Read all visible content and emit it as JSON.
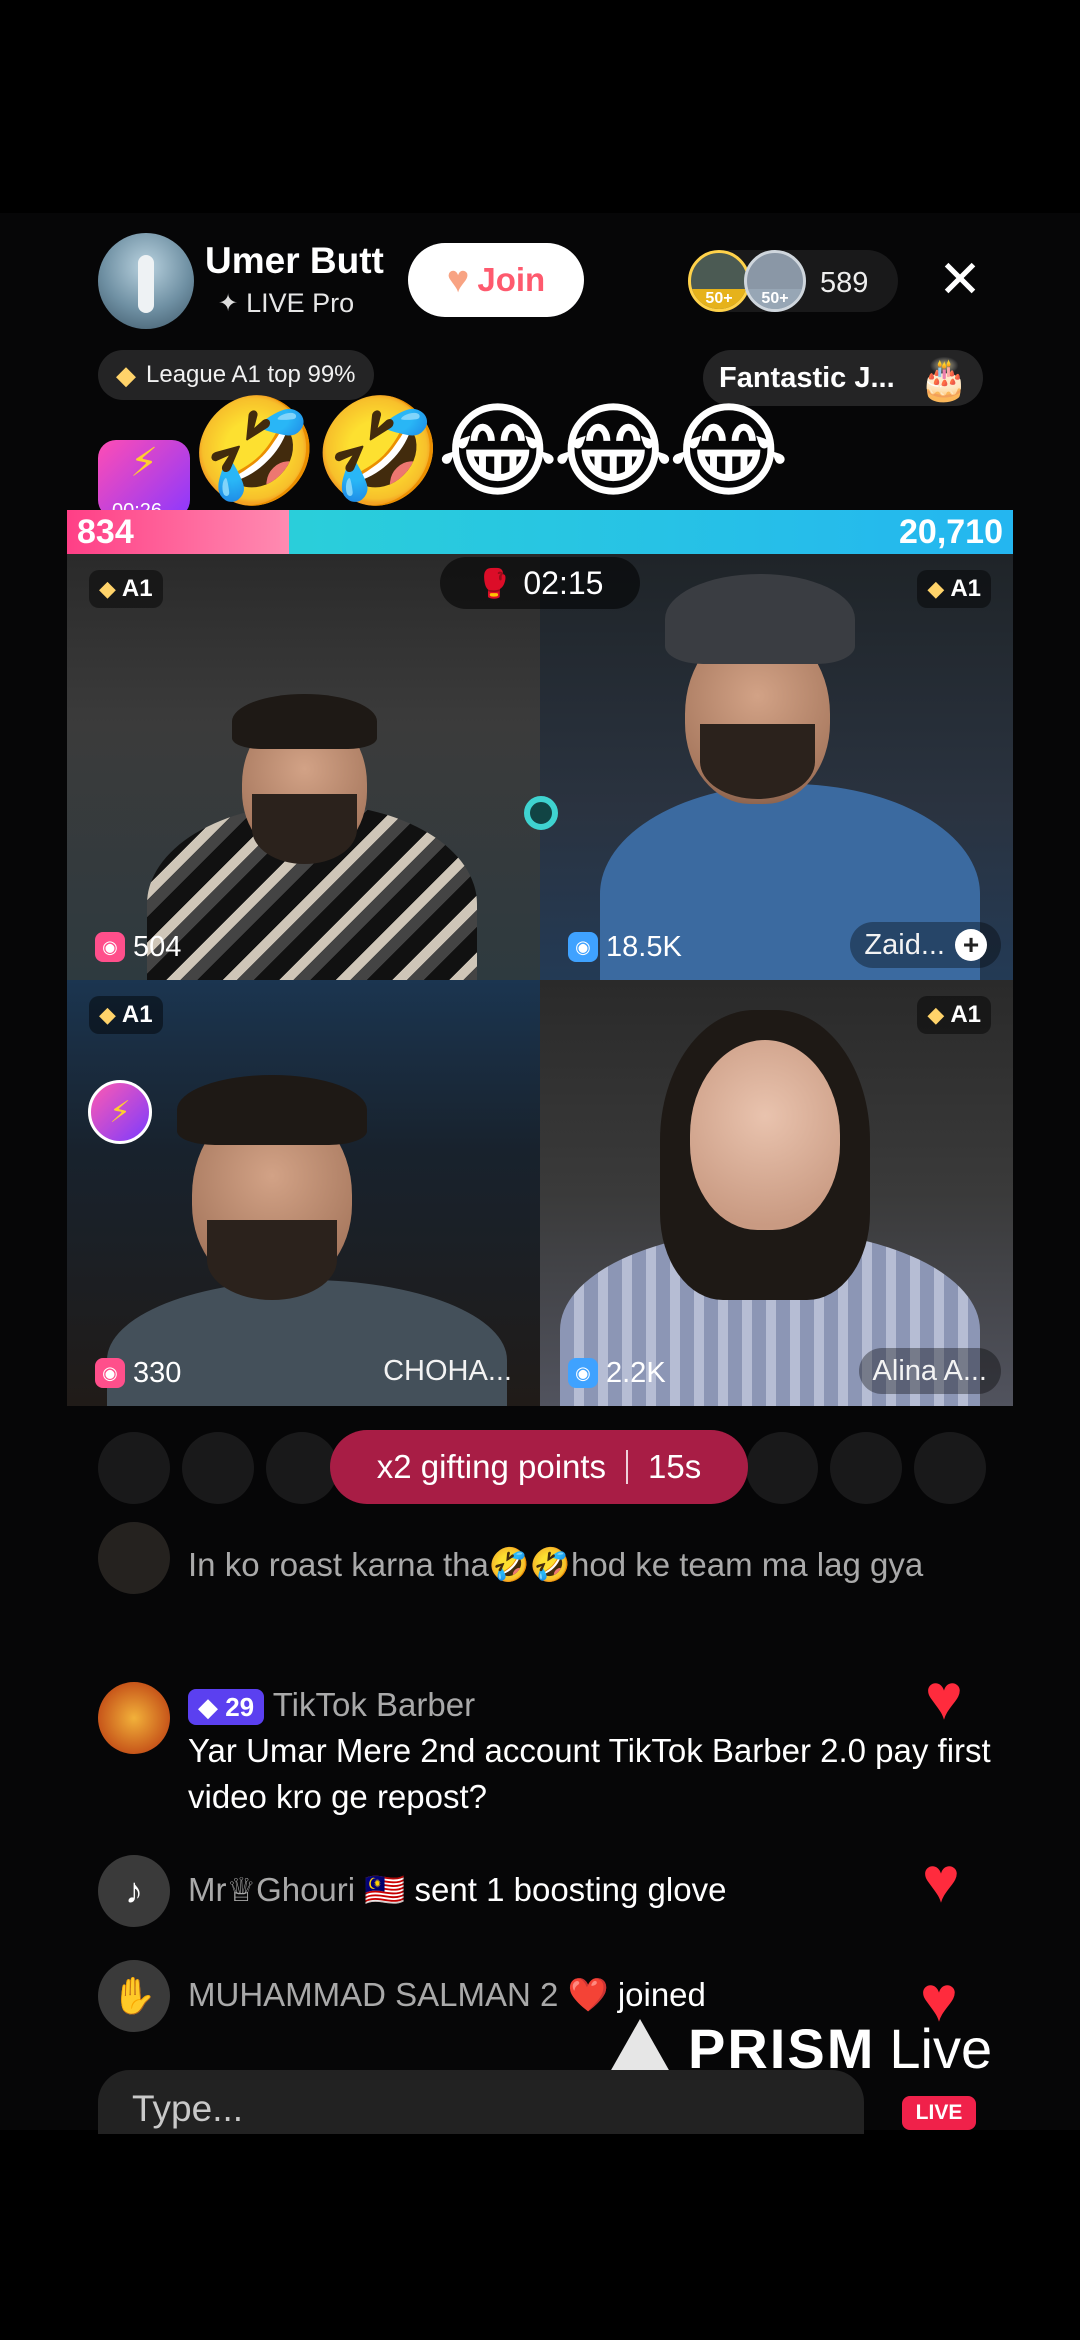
{
  "header": {
    "host_name": "Umer Butt",
    "host_subtitle": "LIVE Pro",
    "join_label": "Join",
    "viewer_rank_badges": [
      "50+",
      "50+"
    ],
    "viewer_count": "589",
    "league_label": "League A1 top 99%",
    "fantastic_label": "Fantastic J..."
  },
  "emoji_reactions": "🤣🤣😂😂😂",
  "boost_timer": "00:26",
  "battle": {
    "left_score": "834",
    "right_score": "20,710",
    "timer": "02:15"
  },
  "tiles": [
    {
      "league": "A1",
      "score": "504",
      "name": ""
    },
    {
      "league": "A1",
      "score": "18.5K",
      "name": "Zaid..."
    },
    {
      "league": "A1",
      "score": "330",
      "name": "CHOHA..."
    },
    {
      "league": "A1",
      "score": "2.2K",
      "name": "Alina A..."
    }
  ],
  "gifting": {
    "label": "x2 gifting points",
    "countdown": "15s"
  },
  "chat": [
    {
      "user": "",
      "text": "In ko roast karna tha🤣🤣hod ke team ma lag gya"
    },
    {
      "level": "29",
      "user": "TikTok Barber",
      "text": "Yar Umar Mere 2nd account TikTok Barber 2.0 pay first video kro ge repost?"
    },
    {
      "user": "Mr♕Ghouri 🇲🇾",
      "text": "sent 1 boosting glove"
    },
    {
      "user": "MUHAMMAD SALMAN 2 ❤️",
      "text": "joined"
    }
  ],
  "watermark": {
    "brand_bold": "PRISM",
    "brand_light": "Live"
  },
  "input": {
    "placeholder": "Type..."
  },
  "live_tag": "LIVE",
  "colors": {
    "accent_pink": "#ff3f86",
    "accent_teal": "#2cd6d3",
    "gift_pill": "#a81d45",
    "heart": "#ff2b3d"
  }
}
